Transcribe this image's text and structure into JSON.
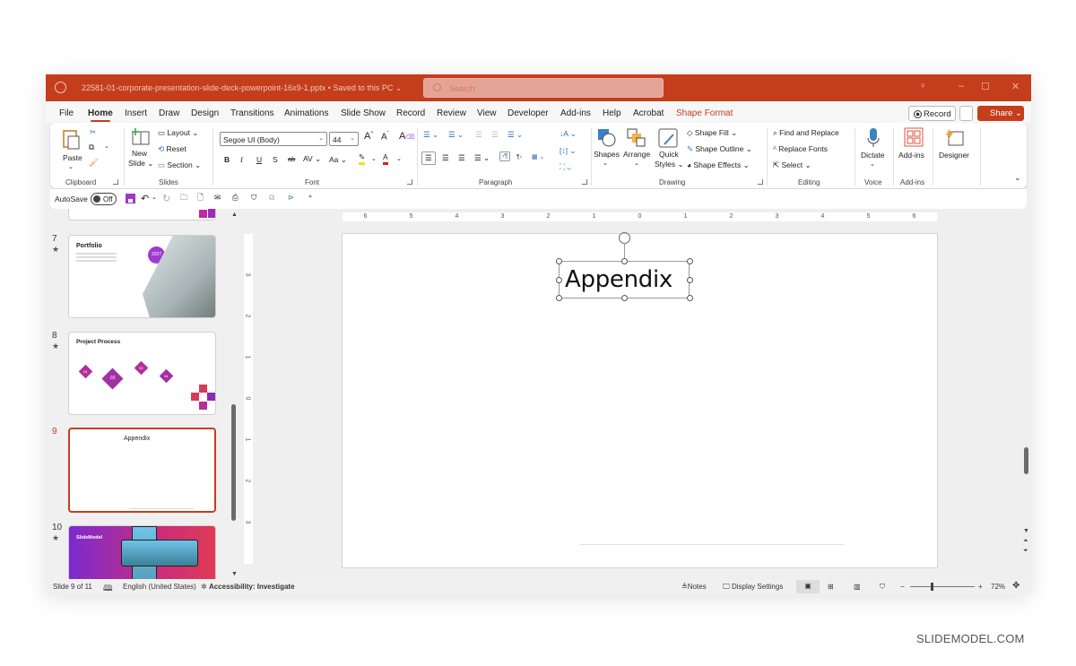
{
  "window": {
    "filename": "22581-01-corporate-presentation-slide-deck-powerpoint-16x9-1.pptx",
    "save_status": "Saved to this PC",
    "search_placeholder": "Search"
  },
  "menu": {
    "tabs": [
      {
        "label": "File"
      },
      {
        "label": "Home",
        "active": true
      },
      {
        "label": "Insert"
      },
      {
        "label": "Draw"
      },
      {
        "label": "Design"
      },
      {
        "label": "Transitions"
      },
      {
        "label": "Animations"
      },
      {
        "label": "Slide Show"
      },
      {
        "label": "Record"
      },
      {
        "label": "Review"
      },
      {
        "label": "View"
      },
      {
        "label": "Developer"
      },
      {
        "label": "Add-ins"
      },
      {
        "label": "Help"
      },
      {
        "label": "Acrobat"
      },
      {
        "label": "Shape Format",
        "contextual": true
      }
    ],
    "record_label": "Record",
    "share_label": "Share"
  },
  "ribbon": {
    "clipboard": {
      "paste": "Paste",
      "group": "Clipboard"
    },
    "slides": {
      "new_slide_1": "New",
      "new_slide_2": "Slide",
      "layout": "Layout",
      "reset": "Reset",
      "section": "Section",
      "group": "Slides"
    },
    "font": {
      "family": "Segoe UI (Body)",
      "size": "44",
      "bold": "B",
      "italic": "I",
      "underline": "U",
      "shadow": "S",
      "strike": "ab",
      "spacing": "AV",
      "case": "Aa",
      "font_color": "A",
      "group": "Font"
    },
    "paragraph": {
      "group": "Paragraph"
    },
    "drawing": {
      "shapes": "Shapes",
      "arrange": "Arrange",
      "quick_styles_1": "Quick",
      "quick_styles_2": "Styles",
      "shape_fill": "Shape Fill",
      "shape_outline": "Shape Outline",
      "shape_effects": "Shape Effects",
      "group": "Drawing"
    },
    "editing": {
      "find_replace": "Find and Replace",
      "replace_fonts": "Replace Fonts",
      "select": "Select",
      "group": "Editing"
    },
    "voice": {
      "dictate": "Dictate",
      "group": "Voice"
    },
    "addins": {
      "addins": "Add-ins",
      "group": "Add-ins"
    },
    "designer": {
      "label": "Designer"
    }
  },
  "qat": {
    "autosave_label": "AutoSave",
    "autosave_state": "Off"
  },
  "thumbnails": [
    {
      "number": "7",
      "title": "Portfolio",
      "badge": "2027",
      "starred": true
    },
    {
      "number": "8",
      "title": "Project Process",
      "steps": [
        "01",
        "02",
        "03",
        "04"
      ],
      "starred": true
    },
    {
      "number": "9",
      "title": "Appendix",
      "selected": true
    },
    {
      "number": "10",
      "brand": "SlideModel",
      "starred": true
    }
  ],
  "rulers": {
    "horizontal": [
      "6",
      "5",
      "4",
      "3",
      "2",
      "1",
      "0",
      "1",
      "2",
      "3",
      "4",
      "5",
      "6"
    ],
    "vertical": [
      "3",
      "2",
      "1",
      "0",
      "1",
      "2",
      "3"
    ]
  },
  "slide": {
    "title": "Appendix"
  },
  "status": {
    "slide_counter": "Slide 9 of 11",
    "language": "English (United States)",
    "accessibility": "Accessibility: Investigate",
    "notes": "Notes",
    "display_settings": "Display Settings",
    "zoom": "72%"
  },
  "watermark": "SLIDEMODEL.COM",
  "colors": {
    "accent": "#c43e1c",
    "ribbon_bg": "#ffffff",
    "workspace": "#f0f0f0"
  }
}
